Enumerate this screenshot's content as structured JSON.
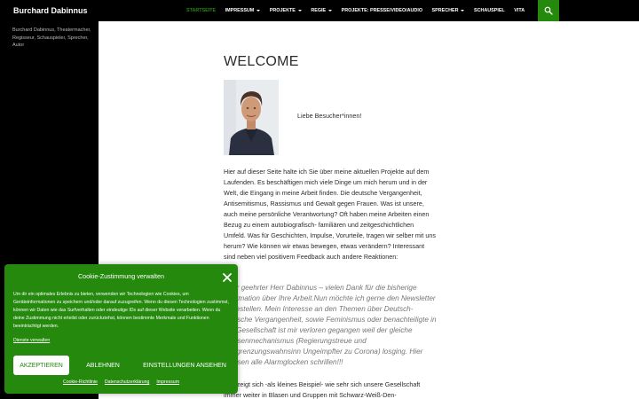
{
  "site": {
    "title": "Burchard Dabinnus",
    "description": "Burchard Dabinnus, Theatermacher, Regisseur, Schauspieler, Sprecher, Autor"
  },
  "nav": {
    "items": [
      {
        "label": "STARTSEITE",
        "active": true,
        "has_dropdown": false
      },
      {
        "label": "IMPRESSUM",
        "active": false,
        "has_dropdown": true
      },
      {
        "label": "PROJEKTE",
        "active": false,
        "has_dropdown": true
      },
      {
        "label": "REGIE",
        "active": false,
        "has_dropdown": true
      },
      {
        "label": "PROJEKTE: PRESSE/VIDEO/AUDIO",
        "active": false,
        "has_dropdown": false
      },
      {
        "label": "SPRECHER",
        "active": false,
        "has_dropdown": true
      },
      {
        "label": "SCHAUSPIEL",
        "active": false,
        "has_dropdown": false
      },
      {
        "label": "VITA",
        "active": false,
        "has_dropdown": false
      }
    ],
    "search_icon": "search-icon"
  },
  "page": {
    "title": "WELCOME",
    "greeting": "Liebe Besucher*innen!",
    "intro": "Hier auf dieser Seite halte ich Sie über meine aktuellen Projekte auf dem Laufenden.  Es beschäftigen mich viele Dinge um mich herum und in der Welt, die Eingang in meine Arbeit finden. Die deutsche Vergangenheit, Antisemitismus, Rassismus und  Gewalt gegen Frauen. Was ist unsere, auch meine persönliche Verantwortung? Oft haben meine Arbeiten einen Bezug zu einem autobiografisch- familiären und zeitgeschichtlichen  Umfeld. Was für Geschichten, Impulse, Vorurteile,  tragen wir selber mit uns herum?  Wie können wir etwas bewegen, etwas verändern?  Interessant sind neben viel positivem Feedback auch andere Reaktionen:",
    "quote": "Sehr geehrter Herr Dabinnus – vielen Dank für die bisherige Information über Ihre Arbeit.Nun möchte ich gerne den Newsletter abbestellen. Mein Interesse an den Themen über Deutsch-Jüdische Vergangenheit, sowie Feminismus oder benachteiligte in der Gesellschaft ist mir verloren gegangen weil der gleiche Massenmechanismus (Regierungstreue und Ausgrenzungswahnsinn Ungeimpfter zu Corona) losging. Hier müssen alle Alarmglocken schrillen!!!",
    "outro": "Das zeigt sich -als kleines Beispiel-  wie sehr sich unsere  Gesellschaft immer weiter in Blasen und Gruppen mit Schwarz-Weiß-Den-"
  },
  "cookie": {
    "title": "Cookie-Zustimmung verwalten",
    "text": "Um dir ein optimales Erlebnis zu bieten, verwenden wir Technologien wie Cookies, um Geräteinformationen zu speichern und/oder darauf zuzugreifen. Wenn du diesen Technologien zustimmst, können wir Daten wie das Surfverhalten oder eindeutige IDs auf dieser Website verarbeiten. Wenn du deine Zustimmung nicht erteilst oder zurückziehst, können bestimmte Merkmale und Funktionen beeinträchtigt werden.",
    "manage_services": "Dienste verwalten",
    "accept": "AKZEPTIEREN",
    "deny": "ABLEHNEN",
    "settings": "EINSTELLUNGEN ANSEHEN",
    "footer_links": [
      "Cookie-Richtlinie",
      "Datenschutzerklärung",
      "Impressum"
    ]
  },
  "colors": {
    "accent": "#24890d",
    "header": "#000000"
  }
}
